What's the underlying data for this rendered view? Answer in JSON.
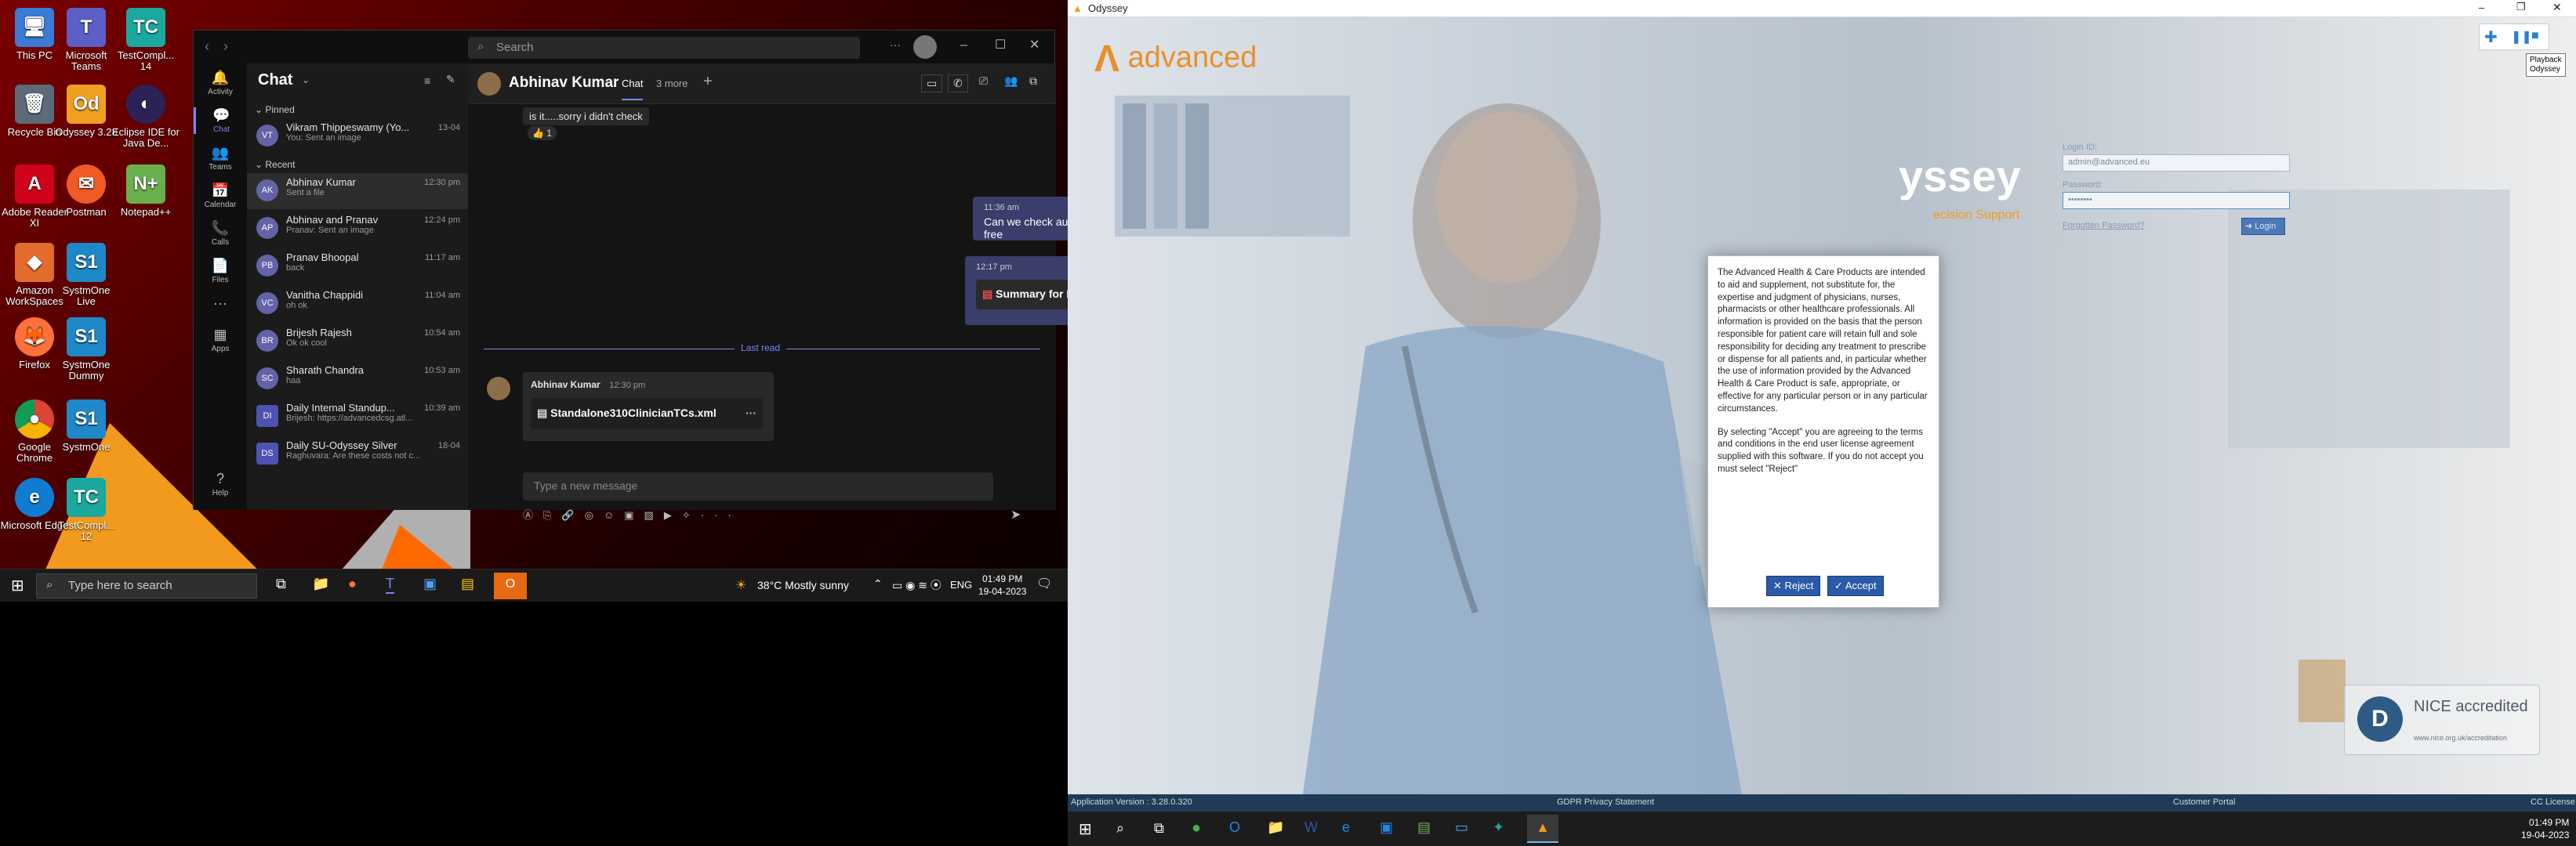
{
  "desktop": {
    "icons": [
      {
        "label": "This PC"
      },
      {
        "label": "Microsoft Teams"
      },
      {
        "label": "TestCompl... 14"
      },
      {
        "label": "Recycle Bin"
      },
      {
        "label": "Odyssey 3.28"
      },
      {
        "label": "Eclipse IDE for Java De..."
      },
      {
        "label": "Adobe Reader XI"
      },
      {
        "label": "Postman"
      },
      {
        "label": "Notepad++"
      },
      {
        "label": "Amazon WorkSpaces"
      },
      {
        "label": "SystmOne Live"
      },
      {
        "label": "Firefox"
      },
      {
        "label": "SystmOne Dummy"
      },
      {
        "label": "Google Chrome"
      },
      {
        "label": "SystmOne"
      },
      {
        "label": "Microsoft Edge"
      },
      {
        "label": "TestCompl... 12"
      }
    ]
  },
  "teams": {
    "search_placeholder": "Search",
    "rail": [
      {
        "label": "Activity"
      },
      {
        "label": "Chat"
      },
      {
        "label": "Teams"
      },
      {
        "label": "Calendar"
      },
      {
        "label": "Calls"
      },
      {
        "label": "Files"
      },
      {
        "label": "Apps"
      },
      {
        "label": "Help"
      }
    ],
    "list_title": "Chat",
    "pinned_label": "Pinned",
    "recent_label": "Recent",
    "pinned": [
      {
        "name": "Vikram Thippeswamy (Yo...",
        "preview": "You: Sent an image",
        "time": "13-04",
        "initials": "VT"
      }
    ],
    "recent": [
      {
        "name": "Abhinav Kumar",
        "preview": "Sent a file",
        "time": "12:30 pm",
        "initials": "AK"
      },
      {
        "name": "Abhinav and Pranav",
        "preview": "Pranav: Sent an image",
        "time": "12:24 pm",
        "initials": "AP"
      },
      {
        "name": "Pranav Bhoopal",
        "preview": "back",
        "time": "11:17 am",
        "initials": "PB"
      },
      {
        "name": "Vanitha Chappidi",
        "preview": "oh ok",
        "time": "11:04 am",
        "initials": "VC"
      },
      {
        "name": "Brijesh Rajesh",
        "preview": "Ok ok cool",
        "time": "10:54 am",
        "initials": "BR"
      },
      {
        "name": "Sharath Chandra",
        "preview": "haa",
        "time": "10:53 am",
        "initials": "SC"
      },
      {
        "name": "Daily Internal Standup...",
        "preview": "Brijesh: https://advancedcsg.atl...",
        "time": "10:39 am",
        "initials": "DI"
      },
      {
        "name": "Daily SU-Odyssey Silver",
        "preview": "Raghuvara: Are these costs not c...",
        "time": "18-04",
        "initials": "DS"
      }
    ],
    "convo": {
      "name": "Abhinav Kumar",
      "tab_chat": "Chat",
      "tab_more": "3 more",
      "msg1": "is it.....sorry i didn't check",
      "reaction": "👍 1",
      "msg2_time": "11:36 am",
      "msg2": "Can we check automation, when ua free",
      "msg3_time": "12:17 pm",
      "msg3_file": "Summary for FC.pdf",
      "last_read": "Last read",
      "msg4_sender": "Abhinav Kumar",
      "msg4_time": "12:30 pm",
      "msg4_file": "Standalone310ClinicianTCs.xml",
      "composer_placeholder": "Type a new message"
    }
  },
  "taskbar1": {
    "search_placeholder": "Type here to search",
    "weather": "38°C  Mostly sunny",
    "lang": "ENG",
    "time": "01:49 PM",
    "date": "19-04-2023"
  },
  "odyssey": {
    "title": "Odyssey",
    "logo": "advanced",
    "brand_partial": "yssey",
    "brand_sub": "ecision Support",
    "tooltip_line1": "Playback",
    "tooltip_line2": "Odyssey",
    "dialog_p1": "The Advanced Health & Care Products are intended to aid and supplement, not substitute for, the expertise and judgment of physicians, nurses, pharmacists or other healthcare professionals. All information is provided on the basis that the person responsible for patient care will retain full and sole responsibility for deciding any treatment to prescribe or dispense for all patients and, in particular whether the use of information provided by the Advanced Health & Care Product is safe, appropriate, or effective for any particular person or in any particular circumstances.",
    "dialog_p2": "By selecting \"Accept\" you are agreeing to the terms and conditions in the end user license agreement supplied with this software. If you do not accept you must select \"Reject\"",
    "reject": "Reject",
    "accept": "Accept",
    "login_id_label": "Login ID:",
    "login_id_value": "admin@advanced.eu",
    "password_label": "Password:",
    "password_value": "••••••••",
    "forgotten": "Forgotten Password?",
    "login_btn": "Login",
    "nice_title": "NICE accredited",
    "nice_url": "www.nice.org.uk/accreditation",
    "status_version": "Application Version : 3.28.0.320",
    "status_gdpr": "GDPR Privacy Statement",
    "status_portal": "Customer Portal",
    "status_license": "CC License",
    "time": "01:49 PM",
    "date": "19-04-2023"
  }
}
